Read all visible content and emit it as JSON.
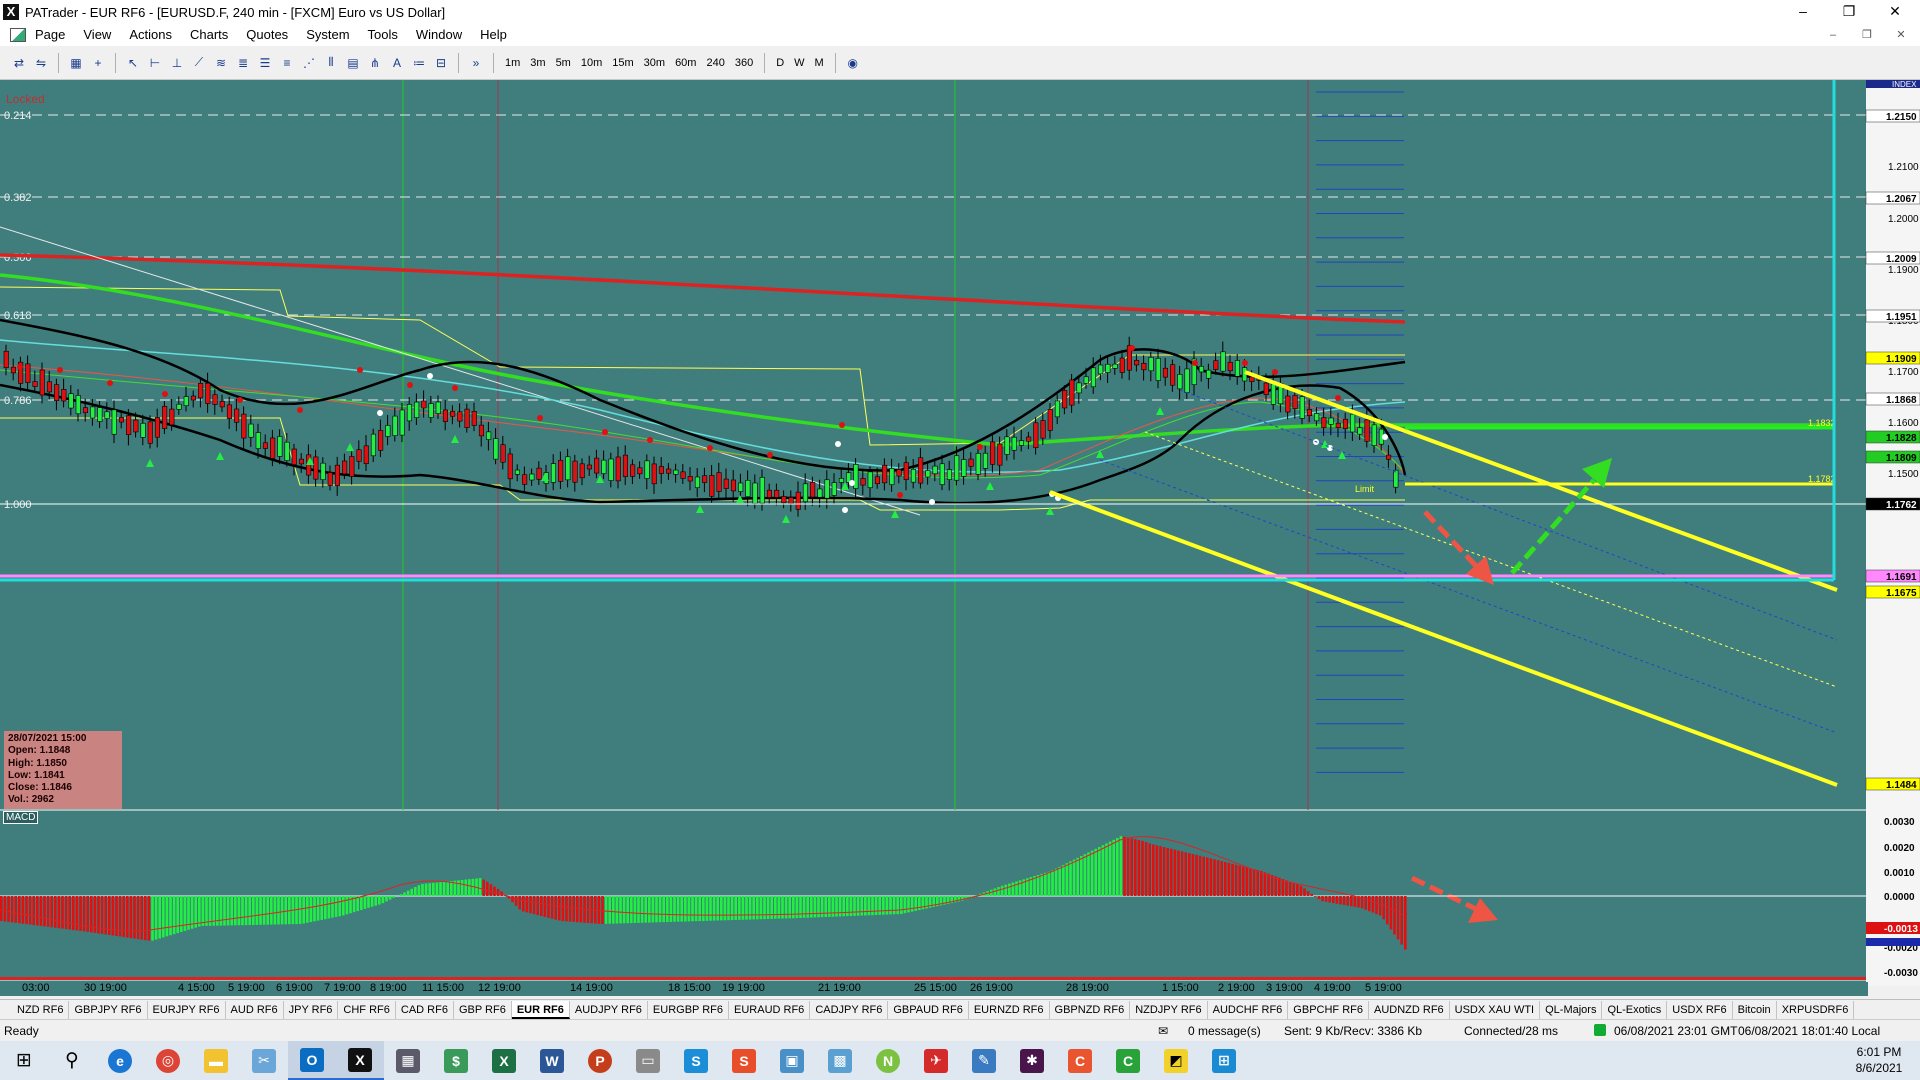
{
  "window": {
    "title": "PATrader - EUR RF6 - [EURUSD.F, 240 min - [FXCM] Euro vs US Dollar]",
    "minimize": "–",
    "restore": "❐",
    "close": "✕"
  },
  "menu": [
    "Page",
    "View",
    "Actions",
    "Charts",
    "Quotes",
    "System",
    "Tools",
    "Window",
    "Help"
  ],
  "timeframes": [
    "1m",
    "3m",
    "5m",
    "10m",
    "15m",
    "30m",
    "60m",
    "240",
    "360",
    "D",
    "W",
    "M"
  ],
  "chart": {
    "locked_label": "Locked",
    "index_label": "INDEX",
    "fib_labels": [
      "0.214",
      "0.382",
      "0.500",
      "0.618",
      "0.786",
      "1.000"
    ],
    "price_ticks": [
      "1.2100",
      "1.2000",
      "1.1900",
      "1.1800",
      "1.1700",
      "1.1600",
      "1.1500"
    ],
    "price_tags": [
      {
        "label": "1.2150",
        "bg": "#ffffff"
      },
      {
        "label": "1.2067",
        "bg": "#ffffff"
      },
      {
        "label": "1.2009",
        "bg": "#ffffff"
      },
      {
        "label": "1.1951",
        "bg": "#ffffff"
      },
      {
        "label": "1.1909",
        "bg": "#ffff00"
      },
      {
        "label": "1.1868",
        "bg": "#ffffff"
      },
      {
        "label": "1.1828",
        "bg": "#22cc22"
      },
      {
        "label": "1.1809",
        "bg": "#22cc22"
      },
      {
        "label": "1.1762",
        "bg": "#000000"
      },
      {
        "label": "1.1691",
        "bg": "#ff88ff"
      },
      {
        "label": "1.1675",
        "bg": "#ffff00"
      },
      {
        "label": "1.1484",
        "bg": "#ffff00"
      }
    ],
    "line_labels": [
      "1.1832",
      "1.1782"
    ],
    "limit_label": "Limit",
    "ohlc": {
      "date": "28/07/2021 15:00",
      "open": "Open: 1.1848",
      "high": "High: 1.1850",
      "low": "Low: 1.1841",
      "close": "Close: 1.1846",
      "vol": "Vol.: 2962"
    },
    "macd_label": "MACD",
    "macd_ticks": [
      "0.0030",
      "0.0020",
      "0.0010",
      "0.0000",
      "-0.0013",
      "-0.0020",
      "-0.0030"
    ],
    "time_labels": [
      "03:00",
      "30 19:00",
      "4 15:00",
      "5 19:00",
      "6 19:00",
      "7 19:00",
      "8 19:00",
      "11 15:00",
      "12 19:00",
      "14 19:00",
      "18 15:00",
      "19 19:00",
      "21 19:00",
      "25 15:00",
      "26 19:00",
      "28 19:00",
      "1 15:00",
      "2 19:00",
      "3 19:00",
      "4 19:00",
      "5 19:00"
    ],
    "colors": {
      "background": "#3f7e7d",
      "bull": "#22ee44",
      "bear": "#dd1111",
      "fib_yellow": "#ffff22",
      "ma_red": "#dd2222",
      "ma_green": "#33dd22",
      "cyan": "#22dddd"
    }
  },
  "tabs": [
    "NZD RF6",
    "GBPJPY RF6",
    "EURJPY RF6",
    "AUD RF6",
    "JPY RF6",
    "CHF RF6",
    "CAD RF6",
    "GBP RF6",
    "EUR RF6",
    "AUDJPY RF6",
    "EURGBP RF6",
    "EURAUD RF6",
    "CADJPY RF6",
    "GBPAUD RF6",
    "EURNZD RF6",
    "GBPNZD RF6",
    "NZDJPY RF6",
    "AUDCHF RF6",
    "GBPCHF RF6",
    "AUDNZD RF6",
    "USDX XAU WTI",
    "QL-Majors",
    "QL-Exotics",
    "USDX RF6",
    "Bitcoin",
    "XRPUSDRF6"
  ],
  "active_tab": "EUR RF6",
  "status": {
    "ready": "Ready",
    "messages": "0 message(s)",
    "traffic": "Sent: 9 Kb/Recv: 3386 Kb",
    "connection": "Connected/28 ms",
    "gmt": "06/08/2021 23:01 GMT",
    "local": "06/08/2021 18:01:40 Local"
  },
  "taskbar": {
    "time": "6:01 PM",
    "date": "8/6/2021"
  }
}
